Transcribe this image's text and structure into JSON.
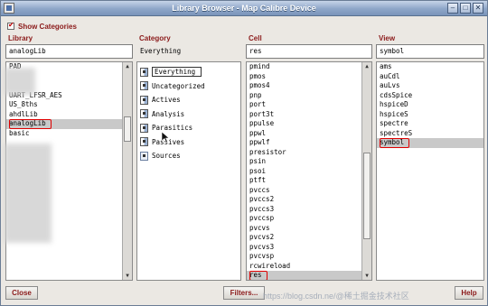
{
  "window": {
    "title": "Library Browser - Map Calibre Device"
  },
  "title_buttons": {
    "minimize": "–",
    "maximize": "□",
    "close": "✕"
  },
  "show_categories": {
    "label": "Show Categories",
    "checked": true
  },
  "library": {
    "header": "Library",
    "filter_value": "analogLib",
    "items": [
      "PAD",
      "",
      "",
      "UART_LFSR_AES",
      "US_8ths",
      "ahdlLib",
      "analogLib",
      "basic"
    ],
    "selected": "analogLib"
  },
  "category": {
    "header": "Category",
    "current": "Everything",
    "items": [
      "Everything",
      "Uncategorized",
      "Actives",
      "Analysis",
      "Parasitics",
      "Passives",
      "Sources"
    ],
    "icons": [
      "category-icon",
      "category-icon",
      "category-icon",
      "category-icon",
      "category-icon",
      "category-icon",
      "sources-icon"
    ]
  },
  "cell": {
    "header": "Cell",
    "filter_value": "res",
    "items": [
      "pmind",
      "pmos",
      "pmos4",
      "pnp",
      "port",
      "port3t",
      "ppulse",
      "ppwl",
      "ppwlf",
      "presistor",
      "psin",
      "psoi",
      "ptft",
      "pvccs",
      "pvccs2",
      "pvccs3",
      "pvccsp",
      "pvcvs",
      "pvcvs2",
      "pvcvs3",
      "pvcvsp",
      "rcwireload",
      "res"
    ],
    "selected": "res"
  },
  "view": {
    "header": "View",
    "filter_value": "symbol",
    "items": [
      "ams",
      "auCdl",
      "auLvs",
      "cdsSpice",
      "hspiceD",
      "hspiceS",
      "spectre",
      "spectreS",
      "symbol"
    ],
    "selected": "symbol"
  },
  "buttons": {
    "close": "Close",
    "filters": "Filters...",
    "help": "Help"
  },
  "watermark": "https://blog.csdn.ne/@稀土掘金技术社区"
}
